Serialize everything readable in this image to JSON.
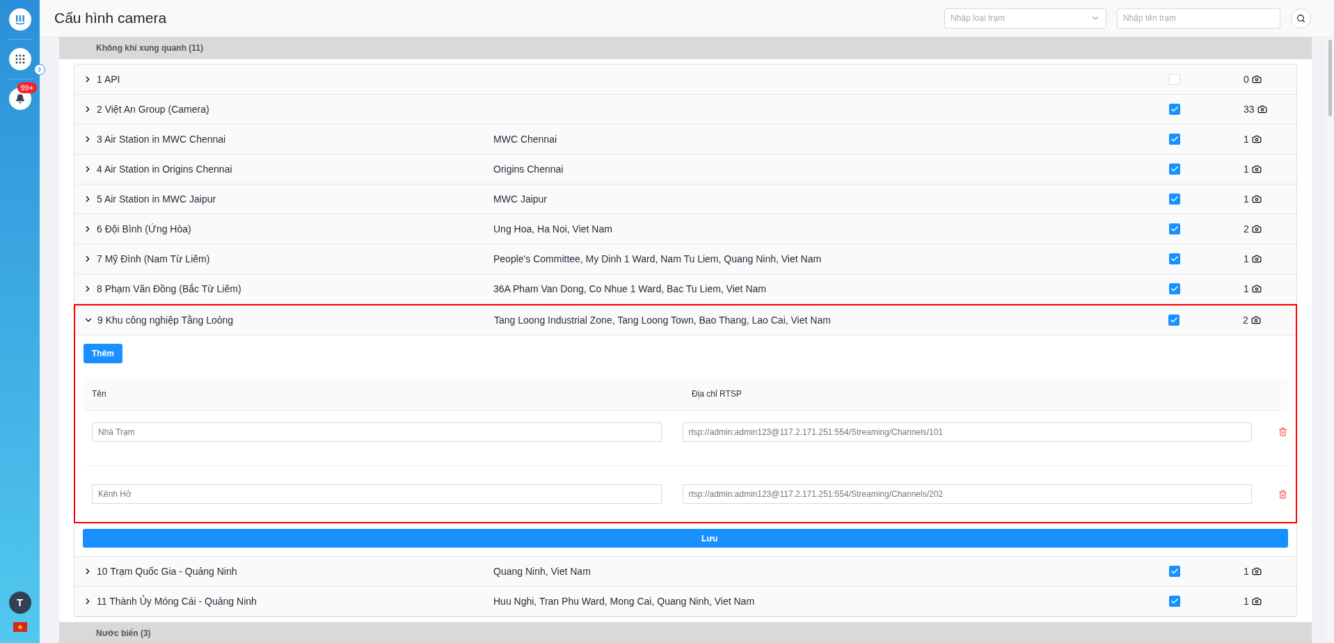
{
  "page": {
    "title": "Cấu hình camera"
  },
  "filters": {
    "type_select": {
      "placeholder": "Nhập loại trạm"
    },
    "name_field": {
      "placeholder": "Nhập tên trạm"
    }
  },
  "sidebar": {
    "notification_badge": "99+",
    "avatar": "T"
  },
  "groups": [
    {
      "title": "Không khí xung quanh (11)",
      "stations": [
        {
          "name": "1 API",
          "checked": false,
          "count": "0",
          "expanded": false
        },
        {
          "name": "2 Việt An Group (Camera)",
          "checked": true,
          "count": "33",
          "expanded": false
        },
        {
          "name": "3 Air Station in MWC Chennai",
          "address": "MWC Chennai",
          "checked": true,
          "count": "1",
          "expanded": false
        },
        {
          "name": "4 Air Station in Origins Chennai",
          "address": "Origins Chennai",
          "checked": true,
          "count": "1",
          "expanded": false
        },
        {
          "name": "5 Air Station in MWC Jaipur",
          "address": "MWC Jaipur",
          "checked": true,
          "count": "1",
          "expanded": false
        },
        {
          "name": "6 Đội Bình (Ứng Hòa)",
          "address": "Ung Hoa, Ha Noi, Viet Nam",
          "checked": true,
          "count": "2",
          "expanded": false
        },
        {
          "name": "7 Mỹ Đình (Nam Từ Liêm)",
          "address": "People's Committee, My Dinh 1 Ward, Nam Tu Liem, Quang Ninh, Viet Nam",
          "checked": true,
          "count": "1",
          "expanded": false
        },
        {
          "name": "8 Phạm Văn Đồng (Bắc Từ Liêm)",
          "address": "36A Pham Van Dong, Co Nhue 1 Ward, Bac Tu Liem, Viet Nam",
          "checked": true,
          "count": "1",
          "expanded": false
        },
        {
          "name": "9 Khu công nghiệp Tằng Loỏng",
          "address": "Tang Loong Industrial Zone, Tang Loong Town, Bao Thang, Lao Cai, Viet Nam",
          "checked": true,
          "count": "2",
          "expanded": true,
          "cameras": {
            "add_button": "Thêm",
            "columns": [
              "Tên",
              "Địa chỉ RTSP"
            ],
            "rows": [
              {
                "name": "Nhà Trạm",
                "rtsp": "rtsp://admin:admin123@117.2.171.251:554/Streaming/Channels/101"
              },
              {
                "name": "Kênh Hở",
                "rtsp": "rtsp://admin:admin123@117.2.171.251:554/Streaming/Channels/202"
              }
            ],
            "save_button": "Lưu"
          }
        },
        {
          "name": "10 Trạm Quốc Gia - Quảng Ninh",
          "address": "Quang Ninh, Viet Nam",
          "checked": true,
          "count": "1",
          "expanded": false
        },
        {
          "name": "11 Thành Ủy Móng Cái - Quảng Ninh",
          "address": "Huu Nghi, Tran Phu Ward, Mong Cai, Quang Ninh, Viet Nam",
          "checked": true,
          "count": "1",
          "expanded": false
        }
      ]
    },
    {
      "title": "Nước biển (3)"
    }
  ]
}
